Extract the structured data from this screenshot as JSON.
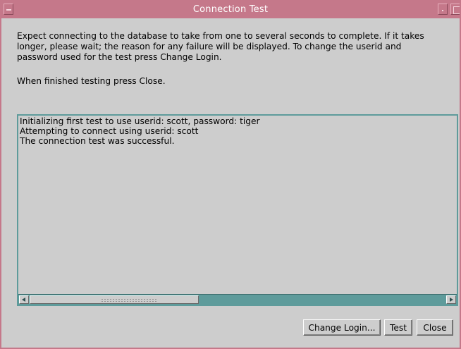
{
  "window": {
    "title": "Connection Test",
    "accent_color": "#c5788a",
    "background_color": "#cdcdcd",
    "output_border_color": "#5e9b9b",
    "title_icons": [
      "window-menu-icon",
      "minimize-icon",
      "maximize-icon"
    ]
  },
  "instructions": "Expect connecting to the database to take from one to several seconds to complete. If it takes\nlonger, please wait; the reason for any failure will be displayed. To change the userid and\npassword used for the test press Change Login.",
  "finished_note": "When finished testing press Close.",
  "output": {
    "lines": [
      "Initializing first test to use userid: scott, password: tiger",
      "Attempting to connect using userid:  scott",
      "The connection test was successful."
    ],
    "scroll_icons": [
      "scroll-left-arrow-icon",
      "scroll-right-arrow-icon"
    ]
  },
  "buttons": {
    "change_login": "Change Login...",
    "test": "Test",
    "close": "Close"
  }
}
